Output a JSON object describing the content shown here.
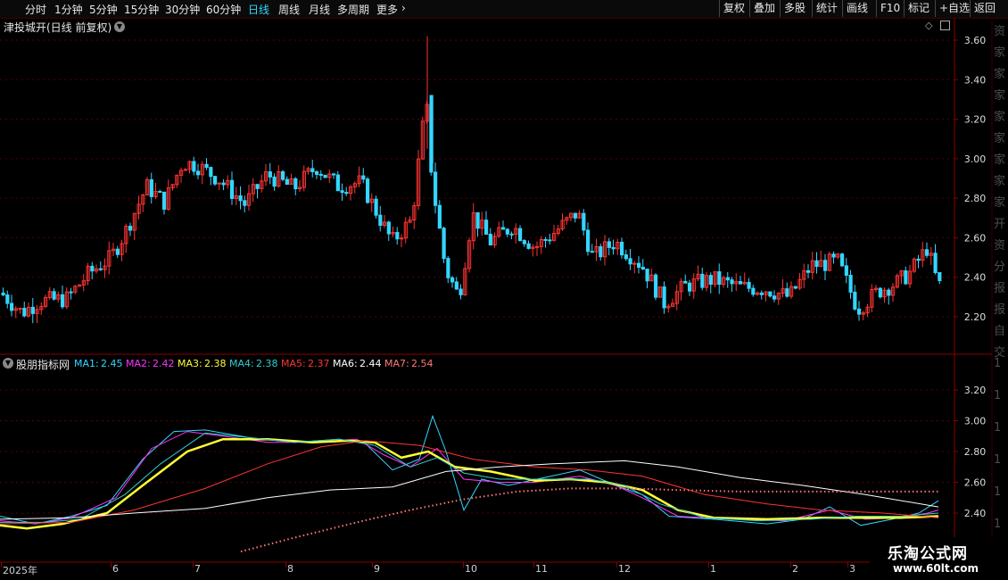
{
  "toolbar": {
    "periods": [
      "分时",
      "1分钟",
      "5分钟",
      "15分钟",
      "30分钟",
      "60分钟",
      "日线",
      "周线",
      "月线",
      "多周期",
      "更多"
    ],
    "active_period": "日线",
    "right_buttons": [
      "复权",
      "叠加",
      "多股",
      "统计",
      "画线",
      "F10",
      "标记",
      "+自选",
      "返回"
    ]
  },
  "main_chart": {
    "title": "津投城开(日线 前复权)",
    "price_ticks": [
      "3.60",
      "3.40",
      "3.20",
      "3.00",
      "2.80",
      "2.60",
      "2.40",
      "2.20"
    ],
    "price_values": [
      3.6,
      3.4,
      3.2,
      3.0,
      2.8,
      2.6,
      2.4,
      2.2
    ]
  },
  "indicator": {
    "name": "股朋指标网",
    "ma_labels": [
      {
        "label": "MA1:",
        "value": "2.45",
        "color": "#33d6ff"
      },
      {
        "label": "MA2:",
        "value": "2.42",
        "color": "#ff33ff"
      },
      {
        "label": "MA3:",
        "value": "2.38",
        "color": "#ffff33"
      },
      {
        "label": "MA4:",
        "value": "2.38",
        "color": "#33cccc"
      },
      {
        "label": "MA5:",
        "value": "2.37",
        "color": "#ff3333"
      },
      {
        "label": "MA6:",
        "value": "2.44",
        "color": "#ffffff"
      },
      {
        "label": "MA7:",
        "value": "2.54",
        "color": "#ff7777"
      }
    ],
    "ticks": [
      "3.20",
      "3.00",
      "2.80",
      "2.60",
      "2.40"
    ],
    "tick_values": [
      3.2,
      3.0,
      2.8,
      2.6,
      2.4
    ]
  },
  "date_axis": {
    "labels": [
      "2025年",
      "6",
      "7",
      "8",
      "9",
      "10",
      "11",
      "12",
      "1",
      "2",
      "3"
    ]
  },
  "right_panel_chars": [
    "资",
    "家",
    "家",
    "家",
    "家",
    "家",
    "家",
    "家",
    "家",
    "开",
    "资",
    "分",
    "报",
    "报",
    "自",
    "交",
    "1",
    "1",
    "1",
    "1",
    "1",
    "1"
  ],
  "watermark": {
    "line1": "乐淘公式网",
    "line2": "www.60lt.com"
  },
  "colors": {
    "up": "#ff3333",
    "down": "#33d6ff",
    "grid": "#5a0000",
    "axis": "#8a0000"
  }
}
